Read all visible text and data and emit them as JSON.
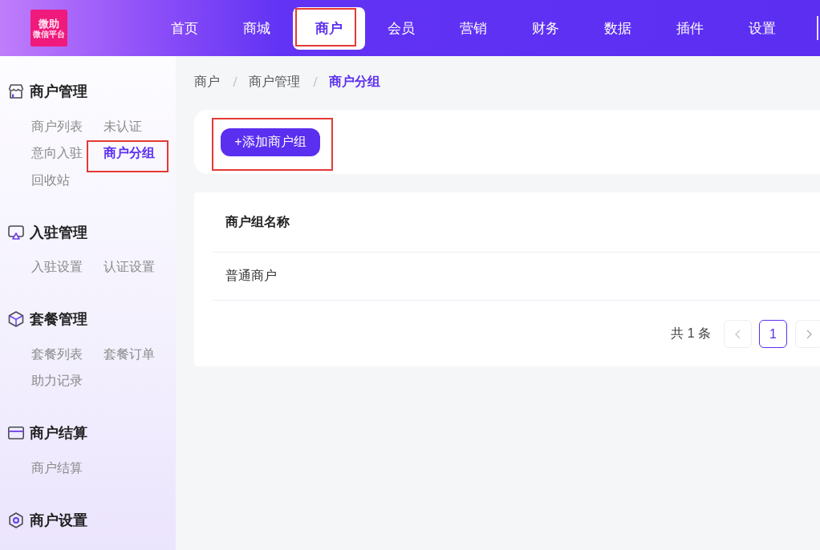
{
  "logo": {
    "title": "微助",
    "subtitle": "微信平台"
  },
  "top_nav": [
    {
      "label": "首页",
      "selected": false,
      "highlighted": false
    },
    {
      "label": "商城",
      "selected": false,
      "highlighted": false
    },
    {
      "label": "商户",
      "selected": true,
      "highlighted": true
    },
    {
      "label": "会员",
      "selected": false,
      "highlighted": false
    },
    {
      "label": "营销",
      "selected": false,
      "highlighted": false
    },
    {
      "label": "财务",
      "selected": false,
      "highlighted": false
    },
    {
      "label": "数据",
      "selected": false,
      "highlighted": false
    },
    {
      "label": "插件",
      "selected": false,
      "highlighted": false
    },
    {
      "label": "设置",
      "selected": false,
      "highlighted": false
    }
  ],
  "sidebar": {
    "groups": [
      {
        "title": "商户管理",
        "kind": "shop",
        "items": [
          {
            "label": "商户列表",
            "selected": false,
            "highlighted": false
          },
          {
            "label": "未认证",
            "selected": false,
            "highlighted": false
          },
          {
            "label": "意向入驻",
            "selected": false,
            "highlighted": false
          },
          {
            "label": "商户分组",
            "selected": true,
            "highlighted": true
          },
          {
            "label": "回收站",
            "selected": false,
            "highlighted": false
          }
        ]
      },
      {
        "title": "入驻管理",
        "kind": "screen",
        "items": [
          {
            "label": "入驻设置",
            "selected": false,
            "highlighted": false
          },
          {
            "label": "认证设置",
            "selected": false,
            "highlighted": false
          }
        ]
      },
      {
        "title": "套餐管理",
        "kind": "package",
        "items": [
          {
            "label": "套餐列表",
            "selected": false,
            "highlighted": false
          },
          {
            "label": "套餐订单",
            "selected": false,
            "highlighted": false
          },
          {
            "label": "助力记录",
            "selected": false,
            "highlighted": false
          }
        ]
      },
      {
        "title": "商户结算",
        "kind": "card",
        "items": [
          {
            "label": "商户结算",
            "selected": false,
            "highlighted": false
          }
        ]
      },
      {
        "title": "商户设置",
        "kind": "settings"
      }
    ]
  },
  "breadcrumb": [
    {
      "label": "商户",
      "current": false
    },
    {
      "label": "商户管理",
      "current": false
    },
    {
      "label": "商户分组",
      "current": true
    }
  ],
  "toolbar": {
    "add_button": {
      "label": "+添加商户组",
      "highlighted": true
    }
  },
  "table": {
    "columns": [
      "商户组名称"
    ],
    "rows": [
      [
        "普通商户"
      ]
    ]
  },
  "pagination": {
    "total": "共 1 条",
    "pages": [
      {
        "label": "1",
        "selected": true
      }
    ]
  }
}
